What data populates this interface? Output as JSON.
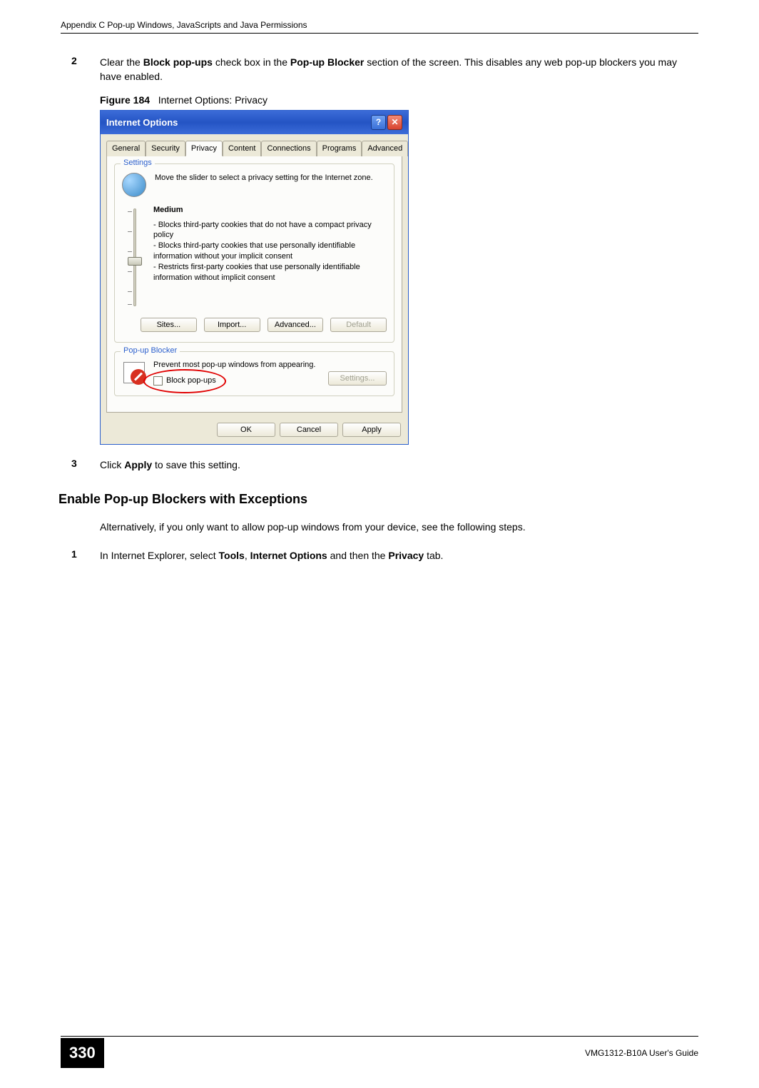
{
  "header": {
    "appendix_title": "Appendix C Pop-up Windows, JavaScripts and Java Permissions"
  },
  "step2": {
    "num": "2",
    "text_before_bold1": "Clear the ",
    "bold1": "Block pop-ups",
    "text_mid": " check box in the ",
    "bold2": "Pop-up Blocker",
    "text_after": " section of the screen. This disables any web pop-up blockers you may have enabled."
  },
  "figure": {
    "label": "Figure 184",
    "caption": "Internet Options: Privacy"
  },
  "dialog": {
    "title": "Internet Options",
    "tabs": [
      "General",
      "Security",
      "Privacy",
      "Content",
      "Connections",
      "Programs",
      "Advanced"
    ],
    "settings": {
      "group_label": "Settings",
      "desc": "Move the slider to select a privacy setting for the Internet zone.",
      "level": "Medium",
      "bullets": "- Blocks third-party cookies that do not have a compact privacy policy\n- Blocks third-party cookies that use personally identifiable information without your implicit consent\n- Restricts first-party cookies that use personally identifiable information without implicit consent",
      "btn_sites": "Sites...",
      "btn_import": "Import...",
      "btn_advanced": "Advanced...",
      "btn_default": "Default"
    },
    "popup": {
      "group_label": "Pop-up Blocker",
      "desc": "Prevent most pop-up windows from appearing.",
      "checkbox_label": "Block pop-ups",
      "btn_settings": "Settings..."
    },
    "ok": "OK",
    "cancel": "Cancel",
    "apply": "Apply"
  },
  "step3": {
    "num": "3",
    "text_before_bold": "Click ",
    "bold": "Apply",
    "text_after": " to save this setting."
  },
  "section": {
    "heading": "Enable Pop-up Blockers with Exceptions",
    "intro": "Alternatively, if you only want to allow pop-up windows from your device, see the following steps."
  },
  "step1b": {
    "num": "1",
    "text_before": "In Internet Explorer, select ",
    "bold1": "Tools",
    "sep1": ", ",
    "bold2": "Internet Options",
    "sep2": " and then the ",
    "bold3": "Privacy",
    "text_after": " tab."
  },
  "footer": {
    "page": "330",
    "guide": "VMG1312-B10A User's Guide"
  }
}
